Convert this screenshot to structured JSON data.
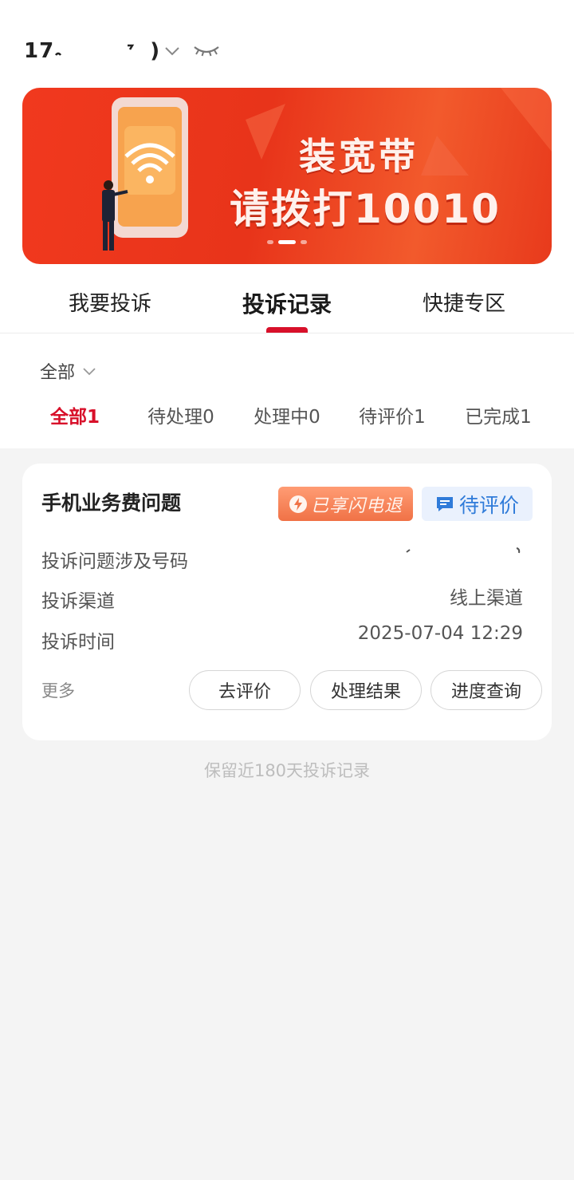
{
  "header": {
    "account_number_visible": "17",
    "account_suffix_visible": ")",
    "dropdown_icon": "chevron-down-icon",
    "visibility_icon": "eye-closed-icon"
  },
  "banner": {
    "line1": "装宽带",
    "line2": "请拨打10010",
    "illustration": "phone-wifi-icon",
    "page_count": 3,
    "active_page": 2
  },
  "tabs": [
    {
      "label": "我要投诉",
      "active": false
    },
    {
      "label": "投诉记录",
      "active": true
    },
    {
      "label": "快捷专区",
      "active": false
    }
  ],
  "filter": {
    "selected": "全部"
  },
  "status_tabs": [
    {
      "label": "全部1",
      "active": true
    },
    {
      "label": "待处理0",
      "active": false
    },
    {
      "label": "处理中0",
      "active": false
    },
    {
      "label": "待评价1",
      "active": false
    },
    {
      "label": "已完成1",
      "active": false
    }
  ],
  "record": {
    "title": "手机业务费问题",
    "refund_badge": "已享闪电退",
    "status_badge": "待评价",
    "fields": [
      {
        "label": "投诉问题涉及号码",
        "value": ""
      },
      {
        "label": "投诉渠道",
        "value": "线上渠道"
      },
      {
        "label": "投诉时间",
        "value": "2025-07-04 12:29"
      }
    ],
    "more_label": "更多",
    "actions": [
      "去评价",
      "处理结果",
      "进度查询"
    ]
  },
  "footnote": "保留近180天投诉记录",
  "colors": {
    "accent_red": "#d8102a",
    "banner_red": "#e8341a",
    "status_blue": "#2f7bd9",
    "refund_orange": "#f07246",
    "page_bg": "#f4f4f4"
  }
}
